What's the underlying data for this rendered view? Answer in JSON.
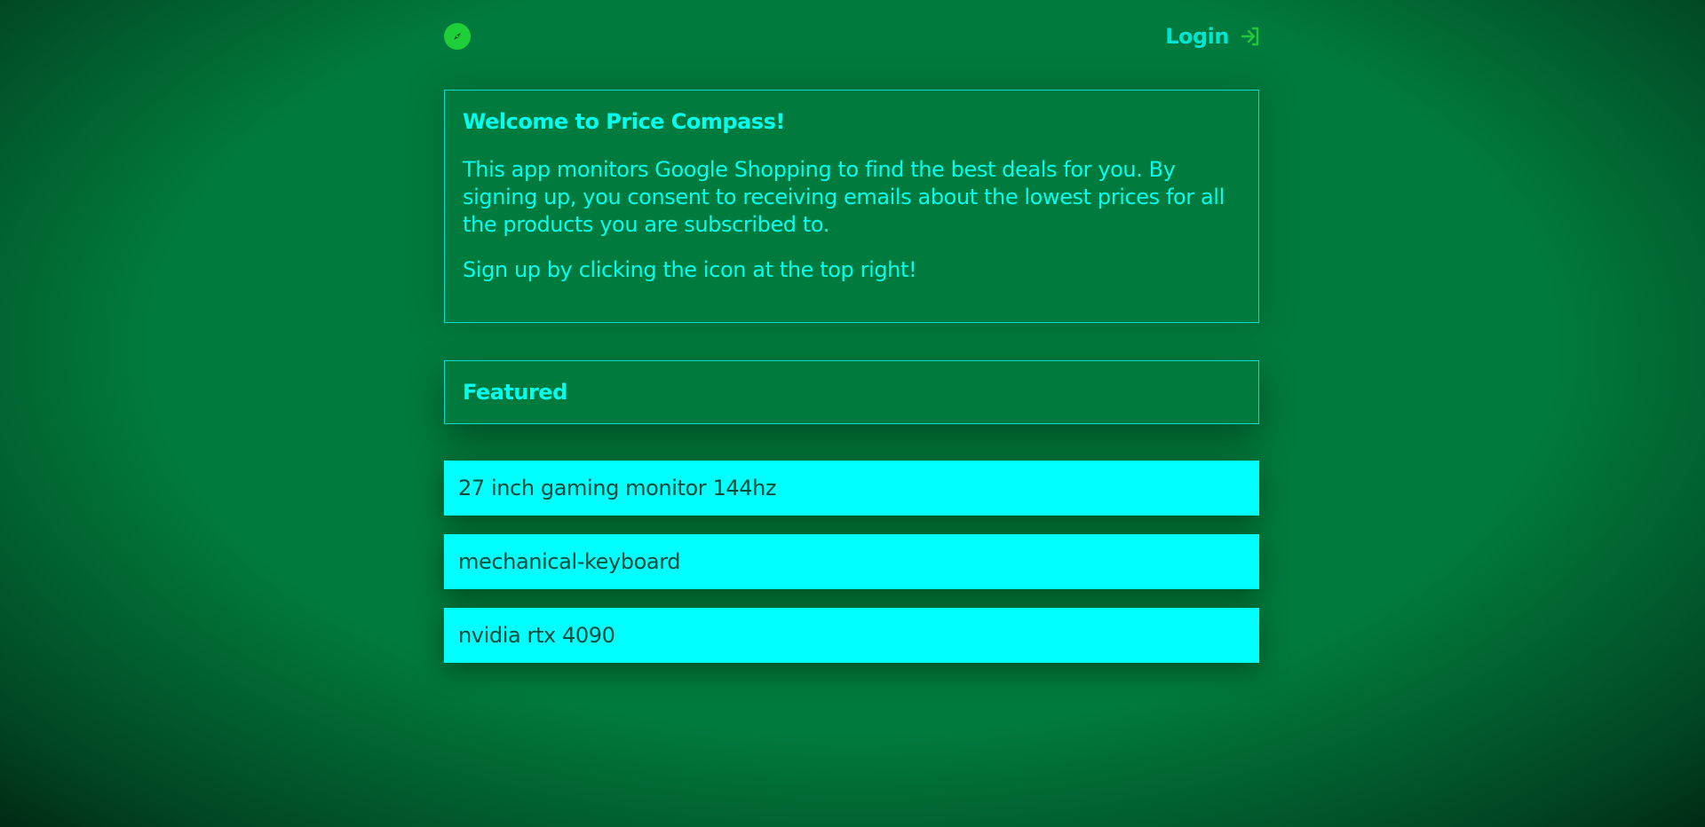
{
  "header": {
    "logo_icon": "compass-icon",
    "login_label": "Login",
    "login_icon": "sign-in-icon"
  },
  "welcome": {
    "title": "Welcome to Price Compass!",
    "paragraph1": "This app monitors Google Shopping to find the best deals for you. By signing up, you consent to receiving emails about the lowest prices for all the products you are subscribed to.",
    "paragraph2": "Sign up by clicking the icon at the top right!"
  },
  "featured": {
    "title": "Featured"
  },
  "products": [
    {
      "name": "27 inch gaming monitor 144hz"
    },
    {
      "name": "mechanical-keyboard"
    },
    {
      "name": "nvidia rtx 4090"
    }
  ],
  "colors": {
    "background": "#017a3e",
    "accent": "#00ffff",
    "logo": "#1fcf3a",
    "product_text": "#0c4a3a"
  }
}
